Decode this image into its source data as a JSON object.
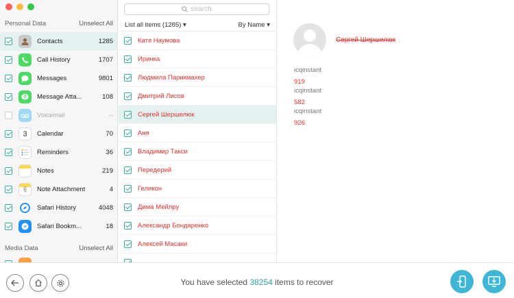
{
  "search": {
    "placeholder": "search"
  },
  "sidebar": {
    "personal_title": "Personal Data",
    "personal_unselect": "Unselect All",
    "media_title": "Media Data",
    "media_unselect": "Unselect All",
    "items": [
      {
        "label": "Contacts",
        "count": "1285",
        "icon": "contacts-icon",
        "color": "#b9b9b9"
      },
      {
        "label": "Call History",
        "count": "1707",
        "icon": "phone-icon",
        "color": "#4cd964"
      },
      {
        "label": "Messages",
        "count": "9801",
        "icon": "messages-icon",
        "color": "#4cd964"
      },
      {
        "label": "Message Atta...",
        "count": "108",
        "icon": "message-attachment-icon",
        "color": "#4cd964"
      },
      {
        "label": "Voicemail",
        "count": "--",
        "icon": "voicemail-icon",
        "color": "#5ac8fa"
      },
      {
        "label": "Calendar",
        "count": "70",
        "icon": "calendar-icon",
        "color": "#ffffff"
      },
      {
        "label": "Reminders",
        "count": "36",
        "icon": "reminders-icon",
        "color": "#ffffff"
      },
      {
        "label": "Notes",
        "count": "219",
        "icon": "notes-icon",
        "color": "#ffd84d"
      },
      {
        "label": "Note Attachment",
        "count": "4",
        "icon": "note-attachment-icon",
        "color": "#ffd84d"
      },
      {
        "label": "Safari History",
        "count": "4048",
        "icon": "safari-icon",
        "color": "#1e90ff"
      },
      {
        "label": "Safari Bookm...",
        "count": "18",
        "icon": "safari-bookmark-icon",
        "color": "#1e90ff"
      }
    ]
  },
  "list": {
    "header_left": "List all items (1285)",
    "header_right": "By Name",
    "rows": [
      "Катя Наумова",
      "Иринка",
      "Людмила Парикмахер",
      "Дмитрий Лисов",
      "Сергей Шершелюк",
      "Аня",
      "Владимир Такси",
      "Передерий",
      "Геликон",
      "Дима Мейлру",
      "Александр Бондаренко",
      "Алексей Масаки"
    ]
  },
  "detail": {
    "name": "Сергей Шершелюк",
    "fields": [
      {
        "label": "icqinstant",
        "value": "919"
      },
      {
        "label": "icqinstant",
        "value": "582"
      },
      {
        "label": "icqinstant",
        "value": "926"
      }
    ]
  },
  "footer": {
    "text_before": "You have selected",
    "count": "38254",
    "text_after": "items to recover"
  },
  "colors": {
    "accent": "#2fa3a0",
    "deleted_text": "#e8302a",
    "action_button": "#3fb6d6"
  }
}
